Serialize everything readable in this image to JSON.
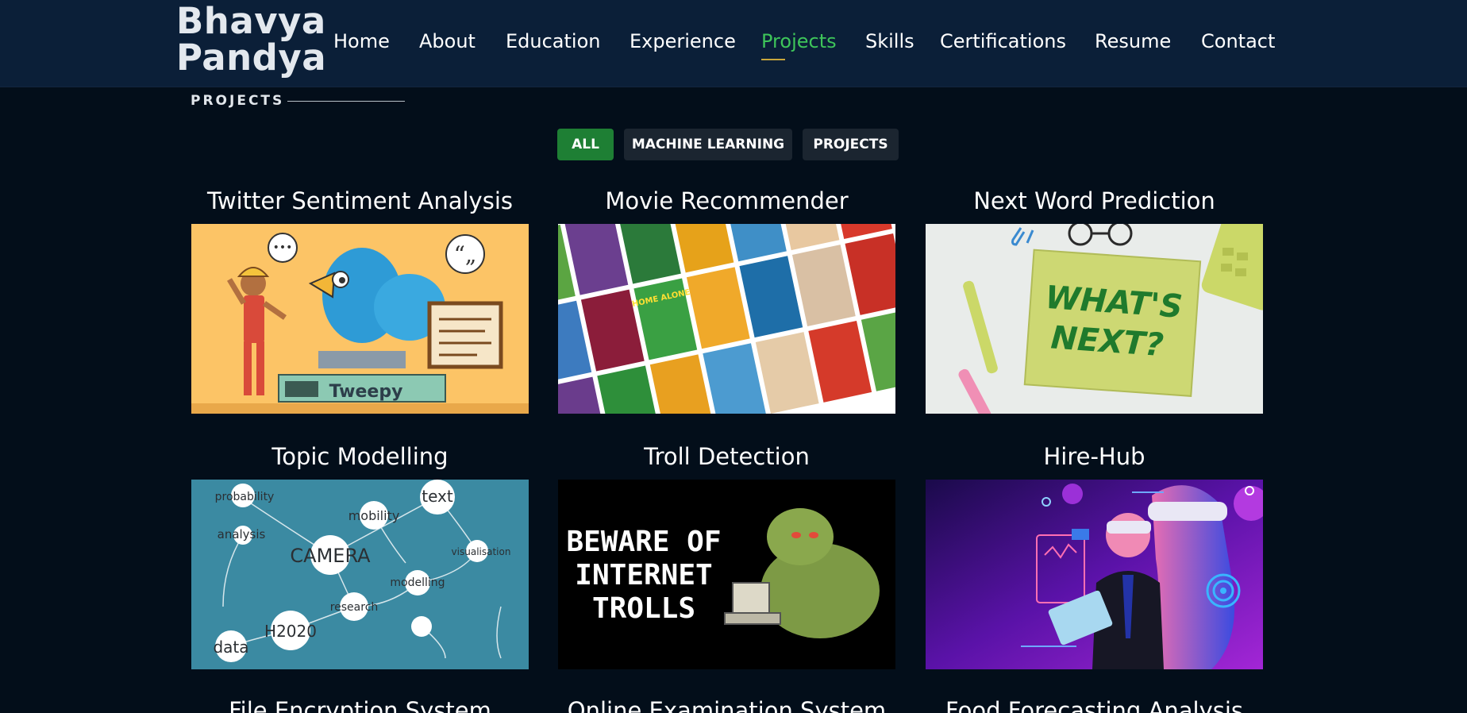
{
  "header": {
    "logo_line1": "Bhavya",
    "logo_line2": "Pandya",
    "nav": [
      {
        "label": "Home",
        "active": false
      },
      {
        "label": "About",
        "active": false
      },
      {
        "label": "Education",
        "active": false
      },
      {
        "label": "Experience",
        "active": false
      },
      {
        "label": "Projects",
        "active": true
      },
      {
        "label": "Skills",
        "active": false
      },
      {
        "label": "Certifications",
        "active": false
      },
      {
        "label": "Resume",
        "active": false
      },
      {
        "label": "Contact",
        "active": false
      }
    ]
  },
  "section": {
    "title": "PROJECTS"
  },
  "filters": [
    {
      "label": "ALL",
      "active": true
    },
    {
      "label": "MACHINE LEARNING",
      "active": false
    },
    {
      "label": "PROJECTS",
      "active": false
    }
  ],
  "projects": [
    {
      "title": "Twitter Sentiment Analysis",
      "image_text": "Tweepy"
    },
    {
      "title": "Movie Recommender",
      "image_text": "HOME ALONE"
    },
    {
      "title": "Next Word Prediction",
      "image_text_1": "WHAT'S",
      "image_text_2": "NEXT?"
    },
    {
      "title": "Topic Modelling",
      "image_text": "CAMERA",
      "image_text_2": "H2020",
      "image_text_3": "data",
      "image_text_4": "text",
      "image_text_5": "probability",
      "image_text_6": "analysis",
      "image_text_7": "mobility",
      "image_text_8": "research",
      "image_text_9": "modelling",
      "image_text_10": "visualisation"
    },
    {
      "title": "Troll Detection",
      "image_text_1": "BEWARE OF",
      "image_text_2": "INTERNET",
      "image_text_3": "TROLLS"
    },
    {
      "title": "Hire-Hub"
    },
    {
      "title": "File Encryption System"
    },
    {
      "title": "Online Examination System"
    },
    {
      "title": "Food Forecasting Analysis"
    }
  ],
  "colors": {
    "header_bg": "#0b1f38",
    "page_bg": "#030e1a",
    "accent_green": "#3ec55a",
    "filter_active": "#1e7f34"
  }
}
